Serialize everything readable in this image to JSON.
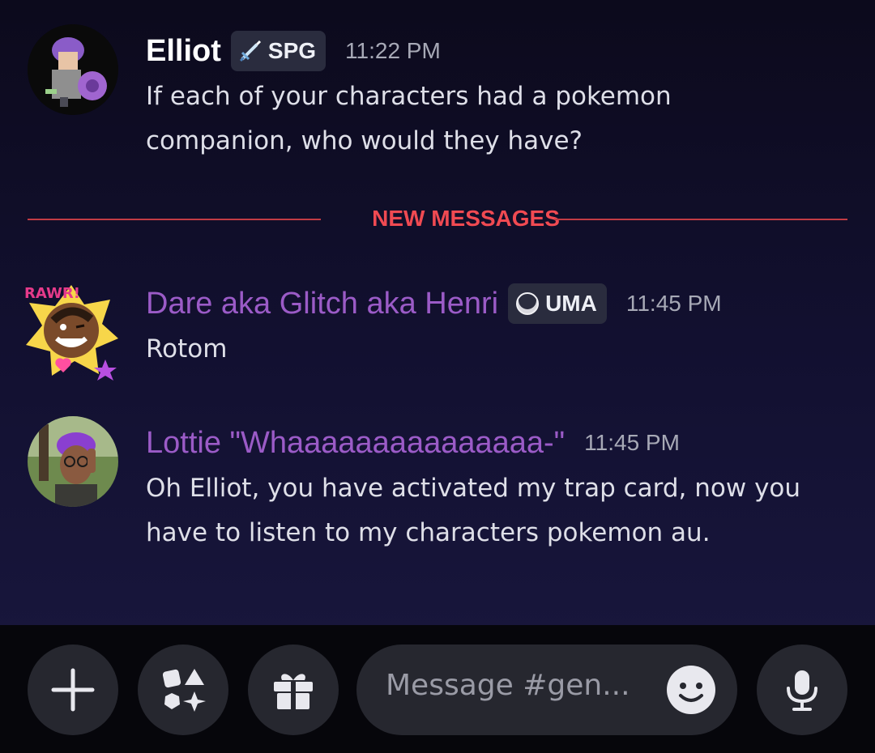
{
  "messages": [
    {
      "author": "Elliot",
      "tag": "SPG",
      "tag_icon": "sword-icon",
      "time": "11:22 PM",
      "lines": [
        "If each of your characters had a pokemon",
        "companion, who would they have?"
      ]
    },
    {
      "author": "Dare aka Glitch aka Henri",
      "tag": "UMA",
      "tag_icon": "moon-icon",
      "time": "11:45 PM",
      "lines": [
        "Rotom"
      ]
    },
    {
      "author": "Lottie \"Whaaaaaaaaaaaaaaa-\"",
      "time": "11:45 PM",
      "lines": [
        "Oh Elliot, you have activated my trap card, now you",
        "have to listen to my characters pokemon au."
      ]
    }
  ],
  "divider": {
    "label": "NEW MESSAGES"
  },
  "composer": {
    "placeholder": "Message #gen...",
    "buttons": [
      "plus-icon",
      "apps-icon",
      "gift-icon",
      "emoji-icon",
      "microphone-icon"
    ]
  },
  "colors": {
    "accent_red": "#f04a52",
    "role_purple": "#9b5bc7",
    "background": "#121030"
  }
}
